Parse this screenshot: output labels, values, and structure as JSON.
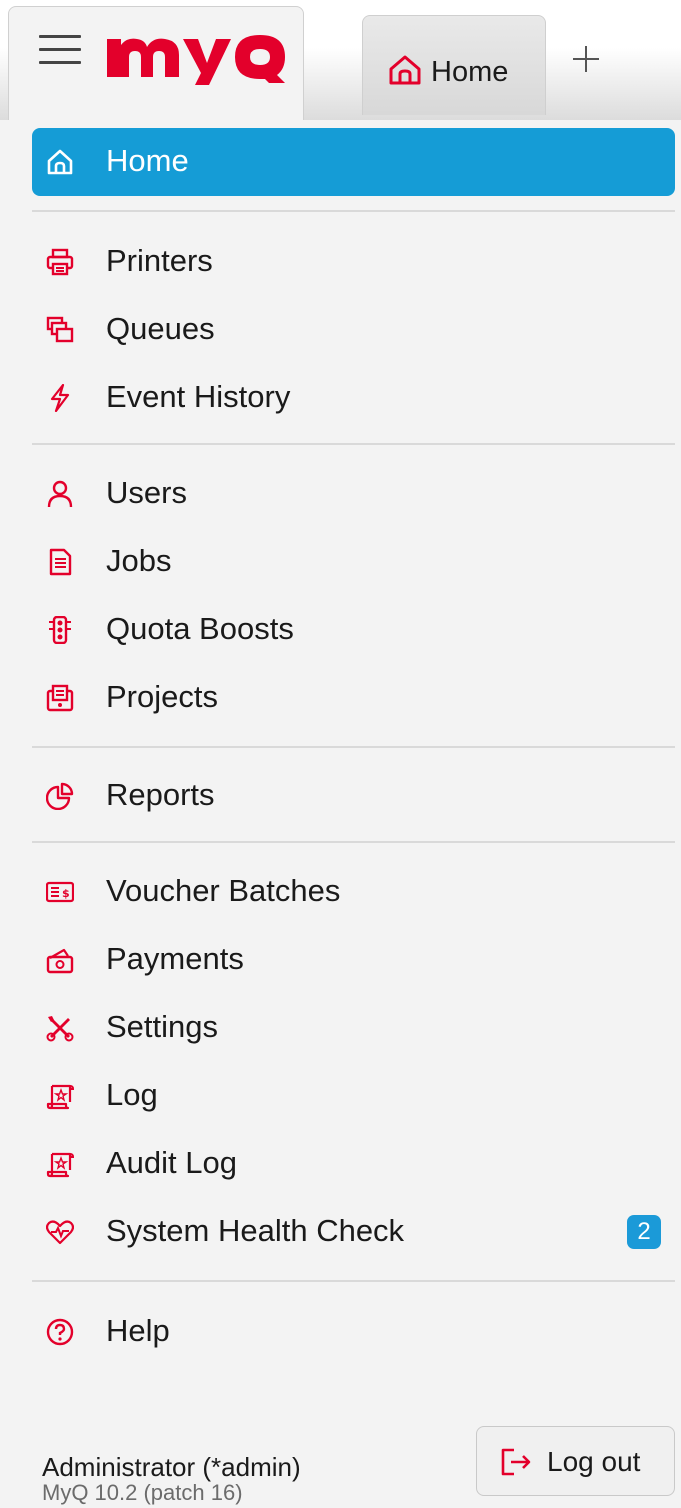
{
  "brand": {
    "logo_text": "myQ",
    "accent_color": "#e3002b",
    "active_color": "#159cd6"
  },
  "tabs": {
    "home_label": "Home",
    "add_icon": "plus-icon"
  },
  "nav": {
    "home": "Home",
    "printers": "Printers",
    "queues": "Queues",
    "event_history": "Event History",
    "users": "Users",
    "jobs": "Jobs",
    "quota_boosts": "Quota Boosts",
    "projects": "Projects",
    "reports": "Reports",
    "voucher_batches": "Voucher Batches",
    "payments": "Payments",
    "settings": "Settings",
    "log": "Log",
    "audit_log": "Audit Log",
    "system_health_check": "System Health Check",
    "system_health_badge": "2",
    "help": "Help"
  },
  "footer": {
    "user": "Administrator (*admin)",
    "version": "MyQ 10.2 (patch 16)",
    "logout_label": "Log out"
  }
}
